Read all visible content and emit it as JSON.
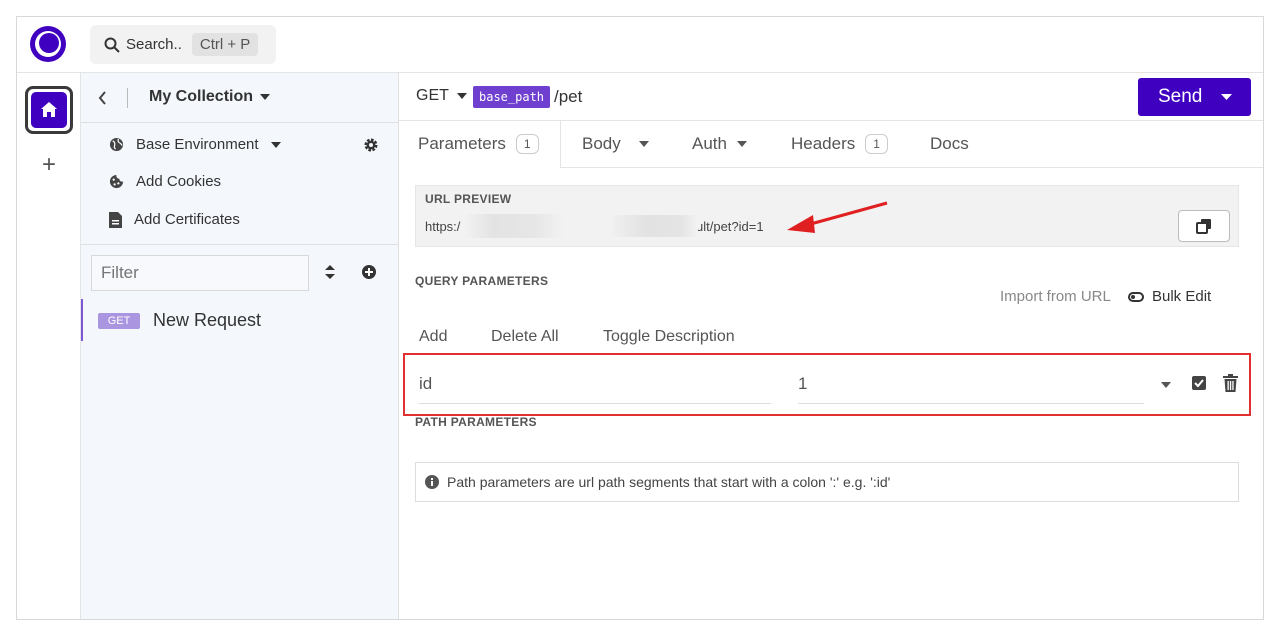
{
  "topbar": {
    "search_label": "Search..",
    "search_shortcut": "Ctrl + P"
  },
  "sidebar": {
    "collection_title": "My Collection",
    "items": [
      {
        "label": "Base Environment",
        "icon": "globe-icon"
      },
      {
        "label": "Add Cookies",
        "icon": "cookie-icon"
      },
      {
        "label": "Add Certificates",
        "icon": "certificate-icon"
      }
    ],
    "filter_placeholder": "Filter",
    "requests": [
      {
        "method": "GET",
        "name": "New Request"
      }
    ]
  },
  "request": {
    "method": "GET",
    "base_path_tag": "base_path",
    "path": "/pet",
    "send_label": "Send"
  },
  "tabs": [
    {
      "label": "Parameters",
      "count": "1"
    },
    {
      "label": "Body"
    },
    {
      "label": "Auth"
    },
    {
      "label": "Headers",
      "count": "1"
    },
    {
      "label": "Docs"
    }
  ],
  "preview": {
    "title": "URL PREVIEW",
    "url_start": "https:/",
    "url_end": "ult/pet?id=1"
  },
  "query": {
    "title": "QUERY PARAMETERS",
    "import_label": "Import from URL",
    "bulk_label": "Bulk Edit",
    "actions": [
      "Add",
      "Delete All",
      "Toggle Description"
    ],
    "params": [
      {
        "name": "id",
        "value": "1"
      }
    ]
  },
  "path_params": {
    "title": "PATH PARAMETERS",
    "info": "Path parameters are url path segments that start with a colon ':' e.g. ':id'"
  },
  "colors": {
    "accent": "#4000bf",
    "tag": "#6f3fd0",
    "highlight": "#e03030"
  }
}
